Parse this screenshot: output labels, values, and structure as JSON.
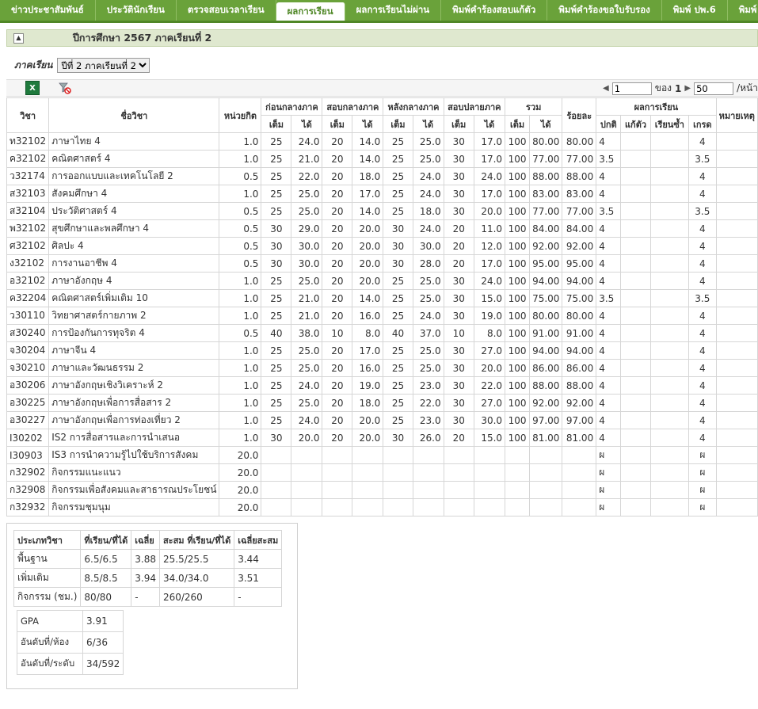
{
  "nav": [
    {
      "label": "ข่าวประชาสัมพันธ์",
      "active": false
    },
    {
      "label": "ประวัตินักเรียน",
      "active": false
    },
    {
      "label": "ตรวจสอบเวลาเรียน",
      "active": false
    },
    {
      "label": "ผลการเรียน",
      "active": true
    },
    {
      "label": "ผลการเรียนไม่ผ่าน",
      "active": false
    },
    {
      "label": "พิมพ์คำร้องสอบแก้ตัว",
      "active": false
    },
    {
      "label": "พิมพ์คำร้องขอใบรับรอง",
      "active": false
    },
    {
      "label": "พิมพ์ ปพ.6",
      "active": false
    },
    {
      "label": "พิมพ์",
      "active": false
    }
  ],
  "year_title": "ปีการศึกษา 2567 ภาคเรียนที่ 2",
  "semester": {
    "label": "ภาคเรียน",
    "selected": "ปีที่ 2 ภาคเรียนที่ 2"
  },
  "pager": {
    "page": "1",
    "of_label": "ของ",
    "total": "1",
    "per_page": "50",
    "per_page_suffix": "/หน้า"
  },
  "table": {
    "headers": {
      "code": "วิชา",
      "name": "ชื่อวิชา",
      "credit": "หน่วยกิต",
      "groups": [
        "ก่อนกลางภาค",
        "สอบกลางภาค",
        "หลังกลางภาค",
        "สอบปลายภาค",
        "รวม"
      ],
      "full": "เต็ม",
      "got": "ได้",
      "percent": "ร้อยละ",
      "result": "ผลการเรียน",
      "result_sub": [
        "ปกติ",
        "แก้ตัว",
        "เรียนซ้ำ",
        "เกรด"
      ],
      "note": "หมายเหตุ"
    },
    "rows": [
      [
        "ท32102",
        "ภาษาไทย 4",
        "1.0",
        "25",
        "24.0",
        "20",
        "14.0",
        "25",
        "25.0",
        "30",
        "17.0",
        "100",
        "80.00",
        "80.00",
        "4",
        "",
        "",
        "4"
      ],
      [
        "ค32102",
        "คณิตศาสตร์ 4",
        "1.0",
        "25",
        "21.0",
        "20",
        "14.0",
        "25",
        "25.0",
        "30",
        "17.0",
        "100",
        "77.00",
        "77.00",
        "3.5",
        "",
        "",
        "3.5"
      ],
      [
        "ว32174",
        "การออกแบบและเทคโนโลยี 2",
        "0.5",
        "25",
        "22.0",
        "20",
        "18.0",
        "25",
        "24.0",
        "30",
        "24.0",
        "100",
        "88.00",
        "88.00",
        "4",
        "",
        "",
        "4"
      ],
      [
        "ส32103",
        "สังคมศึกษา 4",
        "1.0",
        "25",
        "25.0",
        "20",
        "17.0",
        "25",
        "24.0",
        "30",
        "17.0",
        "100",
        "83.00",
        "83.00",
        "4",
        "",
        "",
        "4"
      ],
      [
        "ส32104",
        "ประวัติศาสตร์ 4",
        "0.5",
        "25",
        "25.0",
        "20",
        "14.0",
        "25",
        "18.0",
        "30",
        "20.0",
        "100",
        "77.00",
        "77.00",
        "3.5",
        "",
        "",
        "3.5"
      ],
      [
        "พ32102",
        "สุขศึกษาและพลศึกษา 4",
        "0.5",
        "30",
        "29.0",
        "20",
        "20.0",
        "30",
        "24.0",
        "20",
        "11.0",
        "100",
        "84.00",
        "84.00",
        "4",
        "",
        "",
        "4"
      ],
      [
        "ศ32102",
        "ศิลปะ 4",
        "0.5",
        "30",
        "30.0",
        "20",
        "20.0",
        "30",
        "30.0",
        "20",
        "12.0",
        "100",
        "92.00",
        "92.00",
        "4",
        "",
        "",
        "4"
      ],
      [
        "ง32102",
        "การงานอาชีพ 4",
        "0.5",
        "30",
        "30.0",
        "20",
        "20.0",
        "30",
        "28.0",
        "20",
        "17.0",
        "100",
        "95.00",
        "95.00",
        "4",
        "",
        "",
        "4"
      ],
      [
        "อ32102",
        "ภาษาอังกฤษ 4",
        "1.0",
        "25",
        "25.0",
        "20",
        "20.0",
        "25",
        "25.0",
        "30",
        "24.0",
        "100",
        "94.00",
        "94.00",
        "4",
        "",
        "",
        "4"
      ],
      [
        "ค32204",
        "คณิตศาสตร์เพิ่มเติม 10",
        "1.0",
        "25",
        "21.0",
        "20",
        "14.0",
        "25",
        "25.0",
        "30",
        "15.0",
        "100",
        "75.00",
        "75.00",
        "3.5",
        "",
        "",
        "3.5"
      ],
      [
        "ว30110",
        "วิทยาศาสตร์กายภาพ 2",
        "1.0",
        "25",
        "21.0",
        "20",
        "16.0",
        "25",
        "24.0",
        "30",
        "19.0",
        "100",
        "80.00",
        "80.00",
        "4",
        "",
        "",
        "4"
      ],
      [
        "ส30240",
        "การป้องกันการทุจริต 4",
        "0.5",
        "40",
        "38.0",
        "10",
        "8.0",
        "40",
        "37.0",
        "10",
        "8.0",
        "100",
        "91.00",
        "91.00",
        "4",
        "",
        "",
        "4"
      ],
      [
        "จ30204",
        "ภาษาจีน 4",
        "1.0",
        "25",
        "25.0",
        "20",
        "17.0",
        "25",
        "25.0",
        "30",
        "27.0",
        "100",
        "94.00",
        "94.00",
        "4",
        "",
        "",
        "4"
      ],
      [
        "จ30210",
        "ภาษาและวัฒนธรรม 2",
        "1.0",
        "25",
        "25.0",
        "20",
        "16.0",
        "25",
        "25.0",
        "30",
        "20.0",
        "100",
        "86.00",
        "86.00",
        "4",
        "",
        "",
        "4"
      ],
      [
        "อ30206",
        "ภาษาอังกฤษเชิงวิเคราะห์ 2",
        "1.0",
        "25",
        "24.0",
        "20",
        "19.0",
        "25",
        "23.0",
        "30",
        "22.0",
        "100",
        "88.00",
        "88.00",
        "4",
        "",
        "",
        "4"
      ],
      [
        "อ30225",
        "ภาษาอังกฤษเพื่อการสื่อสาร 2",
        "1.0",
        "25",
        "25.0",
        "20",
        "18.0",
        "25",
        "22.0",
        "30",
        "27.0",
        "100",
        "92.00",
        "92.00",
        "4",
        "",
        "",
        "4"
      ],
      [
        "อ30227",
        "ภาษาอังกฤษเพื่อการท่องเที่ยว 2",
        "1.0",
        "25",
        "24.0",
        "20",
        "20.0",
        "25",
        "23.0",
        "30",
        "30.0",
        "100",
        "97.00",
        "97.00",
        "4",
        "",
        "",
        "4"
      ],
      [
        "I30202",
        "IS2 การสื่อสารและการนำเสนอ",
        "1.0",
        "30",
        "20.0",
        "20",
        "20.0",
        "30",
        "26.0",
        "20",
        "15.0",
        "100",
        "81.00",
        "81.00",
        "4",
        "",
        "",
        "4"
      ],
      [
        "I30903",
        "IS3 การนำความรู้ไปใช้บริการสังคม",
        "20.0",
        "",
        "",
        "",
        "",
        "",
        "",
        "",
        "",
        "",
        "",
        "",
        "ผ",
        "",
        "",
        "ผ"
      ],
      [
        "ก32902",
        "กิจกรรมแนะแนว",
        "20.0",
        "",
        "",
        "",
        "",
        "",
        "",
        "",
        "",
        "",
        "",
        "",
        "ผ",
        "",
        "",
        "ผ"
      ],
      [
        "ก32908",
        "กิจกรรมเพื่อสังคมและสาธารณประโยชน์",
        "20.0",
        "",
        "",
        "",
        "",
        "",
        "",
        "",
        "",
        "",
        "",
        "",
        "ผ",
        "",
        "",
        "ผ"
      ],
      [
        "ก32932",
        "กิจกรรมชุมนุม",
        "20.0",
        "",
        "",
        "",
        "",
        "",
        "",
        "",
        "",
        "",
        "",
        "",
        "ผ",
        "",
        "",
        "ผ"
      ]
    ]
  },
  "summary": {
    "headers": [
      "ประเภทวิชา",
      "ที่เรียน/ที่ได้",
      "เฉลี่ย",
      "สะสม ที่เรียน/ที่ได้",
      "เฉลี่ยสะสม"
    ],
    "rows": [
      [
        "พื้นฐาน",
        "6.5/6.5",
        "3.88",
        "25.5/25.5",
        "3.44"
      ],
      [
        "เพิ่มเติม",
        "8.5/8.5",
        "3.94",
        "34.0/34.0",
        "3.51"
      ],
      [
        "กิจกรรม (ชม.)",
        "80/80",
        "-",
        "260/260",
        "-"
      ]
    ],
    "gpa": [
      [
        "GPA",
        "3.91"
      ],
      [
        "อันดับที่/ห้อง",
        "6/36"
      ],
      [
        "อันดับที่/ระดับ",
        "34/592"
      ]
    ]
  }
}
